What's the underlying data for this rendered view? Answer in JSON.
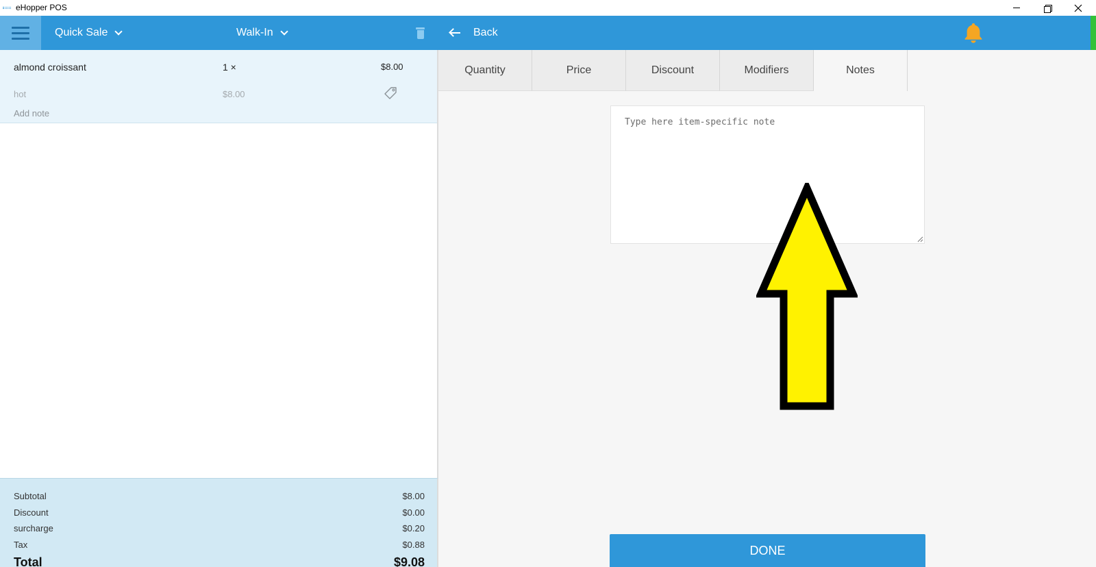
{
  "window": {
    "title": "eHopper POS"
  },
  "left_header": {
    "sale_type": "Quick Sale",
    "customer": "Walk-In"
  },
  "order": {
    "items": [
      {
        "name": "almond croissant",
        "qty": "1 ×",
        "price": "$8.00",
        "modifier": "hot",
        "modifier_price": "$8.00",
        "note_link": "Add note"
      }
    ]
  },
  "totals": {
    "subtotal_label": "Subtotal",
    "subtotal_value": "$8.00",
    "discount_label": "Discount",
    "discount_value": "$0.00",
    "surcharge_label": "surcharge",
    "surcharge_value": "$0.20",
    "tax_label": "Tax",
    "tax_value": "$0.88",
    "total_label": "Total",
    "total_value": "$9.08"
  },
  "right_header": {
    "back_label": "Back",
    "bell_color": "#f5a623"
  },
  "tabs": [
    {
      "label": "Quantity"
    },
    {
      "label": "Price"
    },
    {
      "label": "Discount"
    },
    {
      "label": "Modifiers"
    },
    {
      "label": "Notes"
    }
  ],
  "active_tab": "Notes",
  "note": {
    "value": "",
    "placeholder": "Type here item-specific note"
  },
  "done_label": "DONE",
  "colors": {
    "primary": "#2f97d9",
    "highlight_arrow": "#fff200"
  }
}
